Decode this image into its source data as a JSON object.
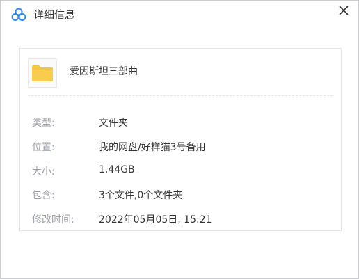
{
  "window": {
    "title": "详细信息",
    "app_icon": "cloud-logo-icon",
    "close_icon": "close-icon"
  },
  "file": {
    "icon": "folder-icon",
    "name": "爱因斯坦三部曲"
  },
  "details": [
    {
      "label": "类型:",
      "value": "文件夹"
    },
    {
      "label": "位置:",
      "value": "我的网盘/好样猫3号备用"
    },
    {
      "label": "大小:",
      "value": "1.44GB"
    },
    {
      "label": "包含:",
      "value": "3个文件,0个文件夹"
    },
    {
      "label": "修改时间:",
      "value": "2022年05月05日, 15:21"
    }
  ],
  "colors": {
    "folder": "#f5c542",
    "label": "#9a9ea6",
    "text": "#333333"
  }
}
